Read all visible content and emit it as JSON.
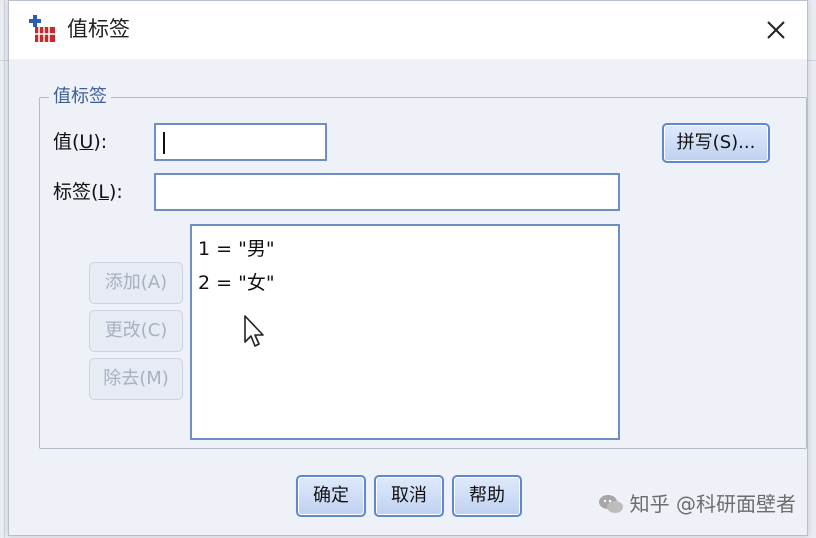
{
  "window": {
    "title": "值标签",
    "close_glyph": "✕"
  },
  "group": {
    "legend": "值标签"
  },
  "fields": {
    "value_label_prefix": "值(",
    "value_label_key": "U",
    "value_label_suffix": "):",
    "value_input": "",
    "label_label_prefix": "标签(",
    "label_label_key": "L",
    "label_label_suffix": "):",
    "label_input": ""
  },
  "buttons": {
    "spell": "拼写(S)...",
    "add": "添加(A)",
    "change": "更改(C)",
    "remove": "除去(M)",
    "ok": "确定",
    "cancel": "取消",
    "help": "帮助"
  },
  "value_labels": [
    "1 = \"男\"",
    "2 = \"女\""
  ],
  "watermark": {
    "text": "知乎 @科研面壁者"
  },
  "colors": {
    "accent": "#5e88cf",
    "legend": "#3f5f98",
    "disabled_text": "#a7b1c2",
    "background": "#eef1f7"
  },
  "icons": {
    "app": "spss-value-labels-icon",
    "close": "close-icon",
    "cursor": "mouse-pointer-icon"
  }
}
